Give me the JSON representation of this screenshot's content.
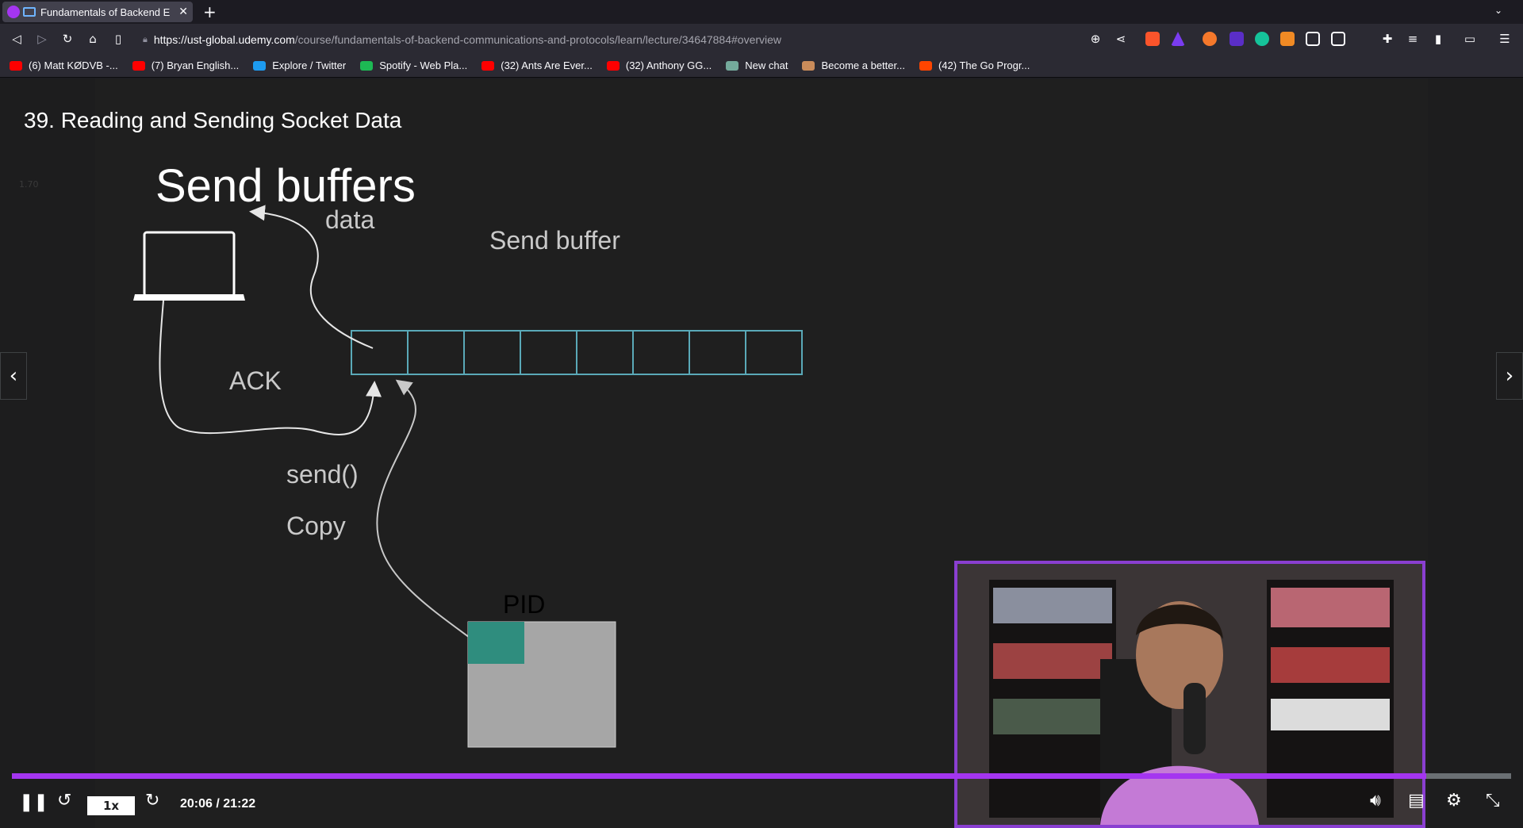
{
  "browser": {
    "tab_title": "Fundamentals of Backend E",
    "url_host": "https://ust-global.udemy.com",
    "url_path": "/course/fundamentals-of-backend-communications-and-protocols/learn/lecture/34647884#overview",
    "bookmarks": [
      {
        "label": "(6) Matt KØDVB -...",
        "icon": "youtube-icon",
        "color": "#ff0000"
      },
      {
        "label": "(7) Bryan English...",
        "icon": "youtube-icon",
        "color": "#ff0000"
      },
      {
        "label": "Explore / Twitter",
        "icon": "twitter-icon",
        "color": "#1d9bf0"
      },
      {
        "label": "Spotify - Web Pla...",
        "icon": "spotify-icon",
        "color": "#1db954"
      },
      {
        "label": "(32) Ants Are Ever...",
        "icon": "youtube-icon",
        "color": "#ff0000"
      },
      {
        "label": "(32) Anthony GG...",
        "icon": "youtube-icon",
        "color": "#ff0000"
      },
      {
        "label": "New chat",
        "icon": "chatgpt-icon",
        "color": "#74aa9c"
      },
      {
        "label": "Become a better...",
        "icon": "profile-icon",
        "color": "#c98b5a"
      },
      {
        "label": "(42) The Go Progr...",
        "icon": "reddit-icon",
        "color": "#ff4500"
      }
    ]
  },
  "lecture": {
    "title": "39. Reading and Sending Socket Data",
    "faint_text": "1.70"
  },
  "slide": {
    "heading": "Send buffers",
    "label_data": "data",
    "label_send_buffer": "Send buffer",
    "label_ack": "ACK",
    "label_send": "send()",
    "label_copy": "Copy",
    "label_pid": "PID",
    "buffer_cells": 8
  },
  "player": {
    "speed": "1x",
    "time": "20:06 / 21:22",
    "progress": 0.9432,
    "accent": "#a435f0"
  }
}
